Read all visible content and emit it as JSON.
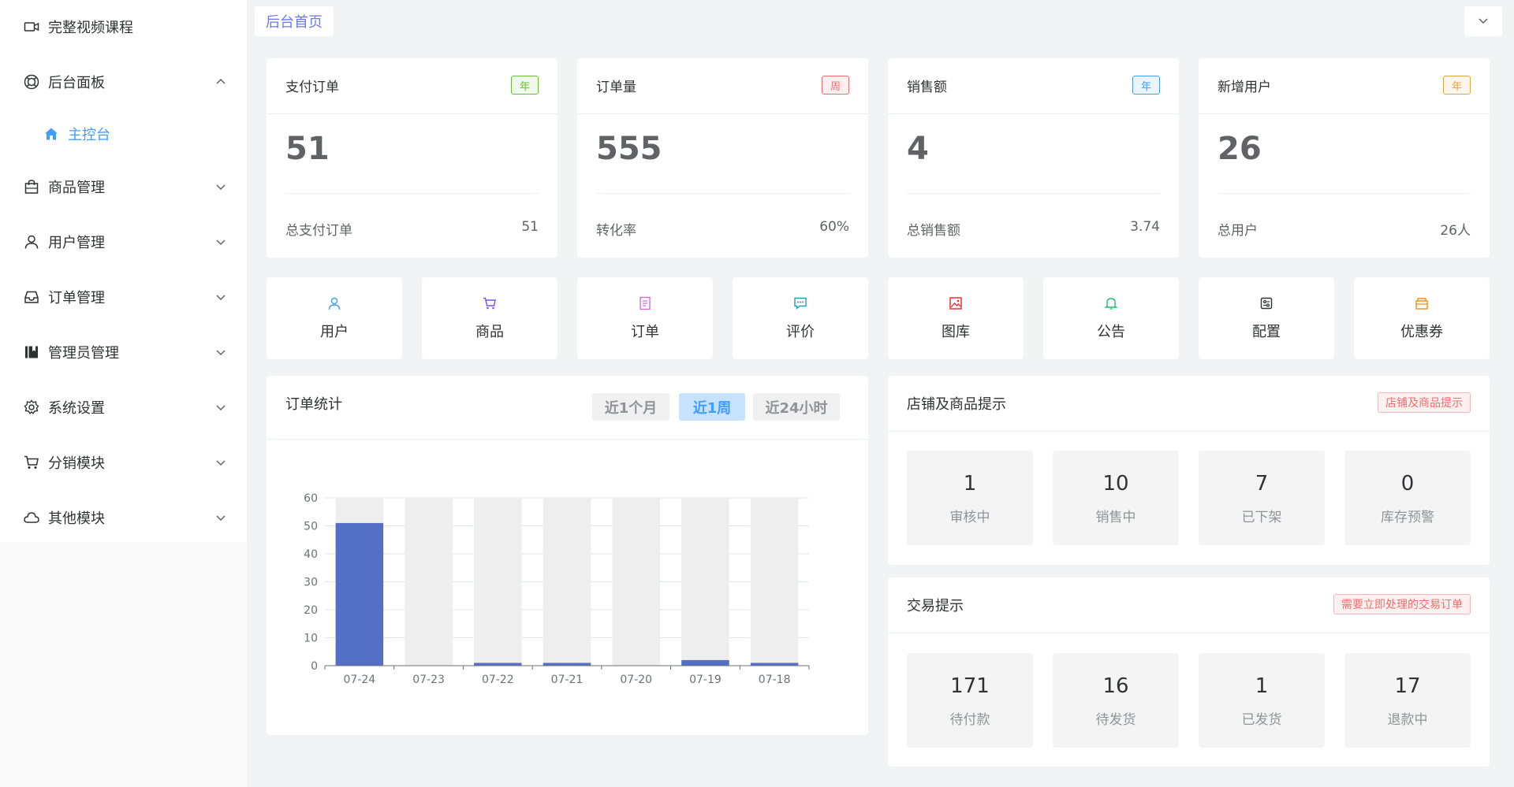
{
  "sidebar": {
    "items": [
      {
        "label": "完整视频课程",
        "icon": "video-camera-icon",
        "arrow": "none"
      },
      {
        "label": "后台面板",
        "icon": "dashboard-icon",
        "arrow": "up"
      },
      {
        "label": "主控台",
        "icon": "home-icon",
        "arrow": "none",
        "active": true
      },
      {
        "label": "商品管理",
        "icon": "shopping-bag-icon",
        "arrow": "down"
      },
      {
        "label": "用户管理",
        "icon": "user-icon",
        "arrow": "down"
      },
      {
        "label": "订单管理",
        "icon": "inbox-icon",
        "arrow": "down"
      },
      {
        "label": "管理员管理",
        "icon": "notebook-icon",
        "arrow": "down"
      },
      {
        "label": "系统设置",
        "icon": "gear-icon",
        "arrow": "down"
      },
      {
        "label": "分销模块",
        "icon": "cart-icon",
        "arrow": "down"
      },
      {
        "label": "其他模块",
        "icon": "cloud-icon",
        "arrow": "down"
      }
    ]
  },
  "topbar": {
    "tab": "后台首页"
  },
  "stats": [
    {
      "title": "支付订单",
      "badge": "年",
      "value": "51",
      "foot_label": "总支付订单",
      "foot_value": "51"
    },
    {
      "title": "订单量",
      "badge": "周",
      "value": "555",
      "foot_label": "转化率",
      "foot_value": "60%"
    },
    {
      "title": "销售额",
      "badge": "年",
      "value": "4",
      "foot_label": "总销售额",
      "foot_value": "3.74"
    },
    {
      "title": "新增用户",
      "badge": "年",
      "value": "26",
      "foot_label": "总用户",
      "foot_value": "26人"
    }
  ],
  "quick_links": [
    {
      "label": "用户",
      "icon": "user-icon",
      "color": "#409eff"
    },
    {
      "label": "商品",
      "icon": "cart-icon",
      "color": "#7c4dff"
    },
    {
      "label": "订单",
      "icon": "document-icon",
      "color": "#d46bd4"
    },
    {
      "label": "评价",
      "icon": "comment-icon",
      "color": "#17a2b8"
    },
    {
      "label": "图库",
      "icon": "picture-icon",
      "color": "#f5222d"
    },
    {
      "label": "公告",
      "icon": "bell-icon",
      "color": "#19be6b"
    },
    {
      "label": "配置",
      "icon": "config-icon",
      "color": "#303133"
    },
    {
      "label": "优惠券",
      "icon": "coupon-icon",
      "color": "#fa8c16"
    }
  ],
  "order_stats": {
    "title": "订单统计",
    "ranges": [
      "近1个月",
      "近1周",
      "近24小时"
    ],
    "active_range": "近1周"
  },
  "chart_data": {
    "type": "bar",
    "categories": [
      "07-24",
      "07-23",
      "07-22",
      "07-21",
      "07-20",
      "07-19",
      "07-18"
    ],
    "values": [
      51,
      0,
      1,
      1,
      0,
      2,
      1
    ],
    "ylim": [
      0,
      60
    ],
    "yticks": [
      0,
      10,
      20,
      30,
      40,
      50,
      60
    ],
    "bar_color": "#5470c6",
    "background_bar_color": "#eeeeee",
    "grid": true
  },
  "shop_tips": {
    "title": "店铺及商品提示",
    "tag": "店铺及商品提示",
    "items": [
      {
        "value": "1",
        "label": "审核中"
      },
      {
        "value": "10",
        "label": "销售中"
      },
      {
        "value": "7",
        "label": "已下架"
      },
      {
        "value": "0",
        "label": "库存预警"
      }
    ]
  },
  "trade_tips": {
    "title": "交易提示",
    "tag": "需要立即处理的交易订单",
    "items": [
      {
        "value": "171",
        "label": "待付款"
      },
      {
        "value": "16",
        "label": "待发货"
      },
      {
        "value": "1",
        "label": "已发货"
      },
      {
        "value": "17",
        "label": "退款中"
      }
    ]
  }
}
